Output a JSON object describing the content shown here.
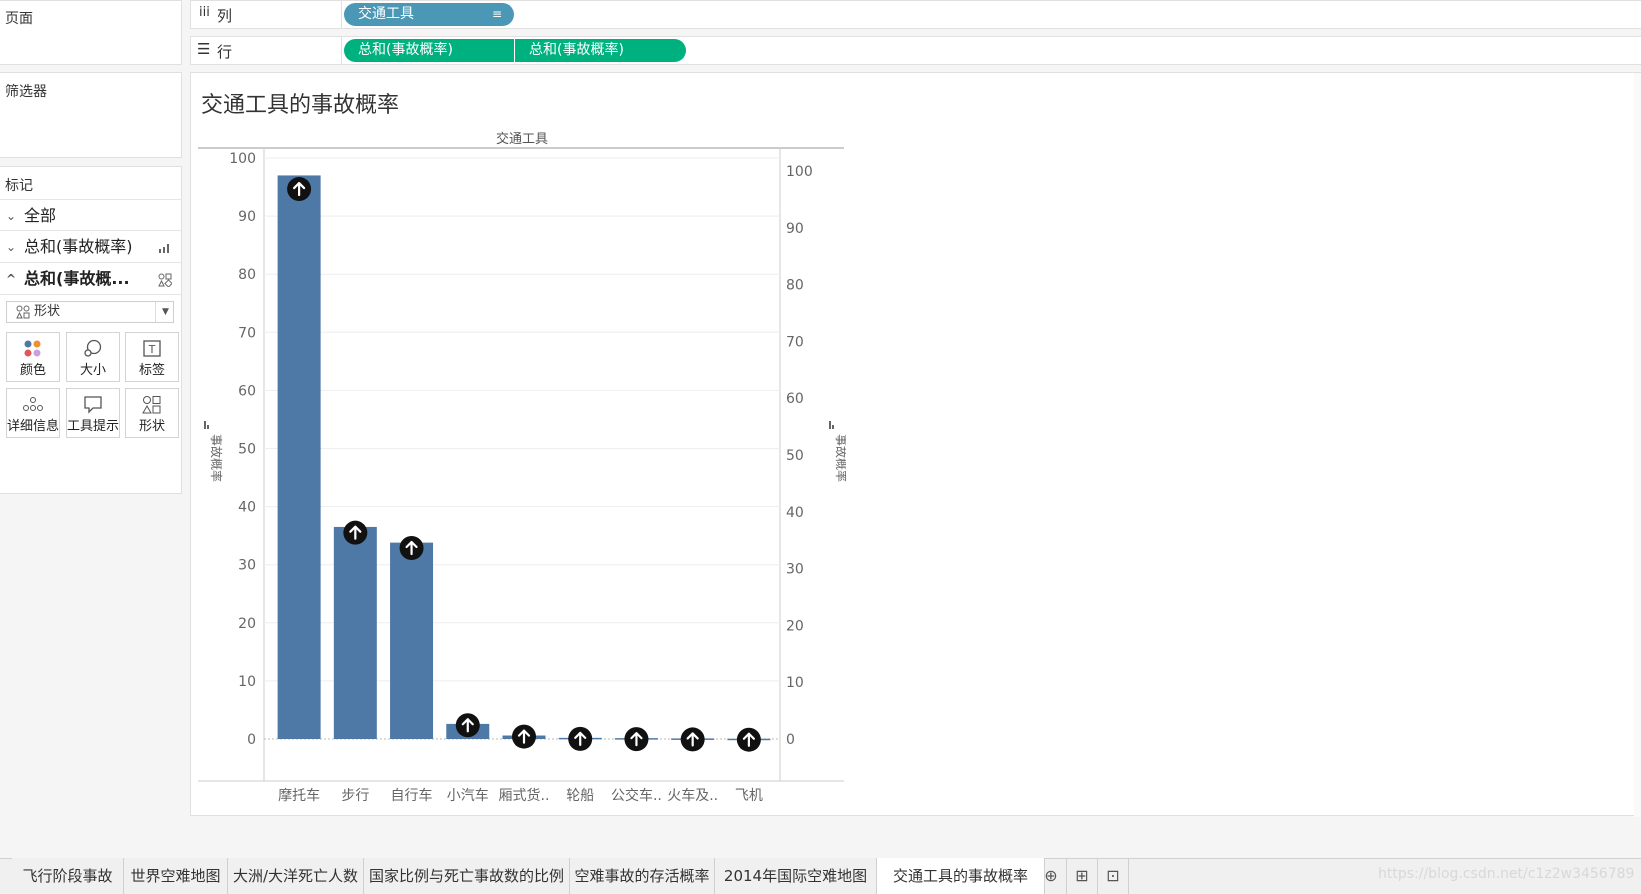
{
  "left_panel": {
    "pages_label": "页面",
    "filters_label": "筛选器",
    "marks_label": "标记",
    "marks_items": [
      {
        "label": "全部",
        "expanded": false
      },
      {
        "label": "总和(事故概率)",
        "expanded": false
      },
      {
        "label": "总和(事故概...",
        "expanded": true
      }
    ],
    "mark_type": "形状",
    "cards": [
      {
        "label": "颜色",
        "icon": "color-icon"
      },
      {
        "label": "大小",
        "icon": "size-icon"
      },
      {
        "label": "标签",
        "icon": "label-icon"
      },
      {
        "label": "详细信息",
        "icon": "detail-icon"
      },
      {
        "label": "工具提示",
        "icon": "tooltip-icon"
      },
      {
        "label": "形状",
        "icon": "shape-icon"
      }
    ]
  },
  "shelves": {
    "columns_label": "列",
    "rows_label": "行",
    "columns_pills": [
      "交通工具"
    ],
    "rows_pills": [
      "总和(事故概率)",
      "总和(事故概率)"
    ]
  },
  "sheet": {
    "title": "交通工具的事故概率"
  },
  "chart_data": {
    "type": "bar",
    "header": "交通工具",
    "categories": [
      "摩托车",
      "步行",
      "自行车",
      "小汽车",
      "厢式货..",
      "轮船",
      "公交车..",
      "火车及..",
      "飞机"
    ],
    "values": [
      97,
      36.5,
      33.8,
      2.6,
      0.6,
      0.2,
      0.15,
      0.1,
      0.05
    ],
    "ylabel_left": "事故概率",
    "ylabel_right": "事故概率",
    "y_ticks": [
      0,
      10,
      20,
      30,
      40,
      50,
      60,
      70,
      80,
      90,
      100
    ],
    "ylim": [
      0,
      100
    ],
    "bar_color": "#4e79a7",
    "shape_marker": "circle-arrow-up",
    "grid": true
  },
  "tabs": [
    {
      "label": "飞行阶段事故",
      "active": false
    },
    {
      "label": "世界空难地图",
      "active": false
    },
    {
      "label": "大洲/大洋死亡人数",
      "active": false
    },
    {
      "label": "国家比例与死亡事故数的比例",
      "active": false
    },
    {
      "label": "空难事故的存活概率",
      "active": false
    },
    {
      "label": "2014年国际空难地图",
      "active": false
    },
    {
      "label": "交通工具的事故概率",
      "active": true
    }
  ],
  "watermark": "https://blog.csdn.net/c1z2w3456789"
}
